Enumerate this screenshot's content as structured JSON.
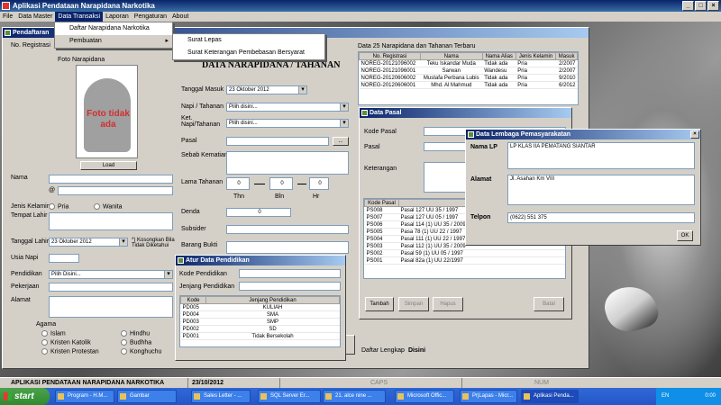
{
  "app": {
    "title": "Aplikasi Pendataan Narapidana Narkotika",
    "window_buttons": [
      "_",
      "□",
      "×"
    ]
  },
  "menubar": [
    {
      "label": "File",
      "active": false
    },
    {
      "label": "Data Master",
      "active": false
    },
    {
      "label": "Data Transaksi",
      "active": true
    },
    {
      "label": "Laporan",
      "active": false
    },
    {
      "label": "Pengaturan",
      "active": false
    },
    {
      "label": "About",
      "active": false
    }
  ],
  "menu_dropdown": {
    "items": [
      "Daftar Narapidana Narkotika",
      "Pembuatan"
    ],
    "submenu": [
      "Surat Lepas",
      "Surat Keterangan Pembebasan Bersyarat"
    ]
  },
  "pendaftaran": {
    "title": "Pendaftaran",
    "no_registrasi_label": "No. Registrasi",
    "foto_label": "Foto Narapidana",
    "photo_placeholder": "Foto tidak ada",
    "load_button": "Load",
    "nama_label": "Nama",
    "alias_label": "@",
    "jenis_kelamin_label": "Jenis Kelamin",
    "jenis_kelamin_options": [
      "Pria",
      "Wanita"
    ],
    "tempat_lahir_label": "Tempat Lahir",
    "tanggal_lahir_label": "Tanggal Lahir",
    "tanggal_lahir_value": "23  Oktober  2012",
    "kosongkan_label": "*) Kosongkan Bila Tidak Diketahui",
    "usia_label": "Usia Napi",
    "pendidikan_label": "Pendidikan",
    "pendidikan_value": "Pilih Disini...",
    "pekerjaan_label": "Pekerjaan",
    "alamat_label": "Alamat",
    "agama_label": "Agama",
    "agama_options": [
      "Islam",
      "Hindhu",
      "Kristen Katolik",
      "Budhha",
      "Kristen Protestan",
      "Konghuchu"
    ],
    "heading": "DATA NARAPIDANA / TAHANAN",
    "tanggal_masuk_label": "Tanggal Masuk",
    "tanggal_masuk_value": "23  Oktober  2012",
    "napi_tahanan_label": "Napi / Tahanan",
    "napi_tahanan_value": "Pilih disini...",
    "ket_label": "Ket. Napi/Tahanan",
    "ket_value": "Pilih disini...",
    "pasal_label": "Pasal",
    "pasal_button": "...",
    "sebab_label": "Sebab Kematian",
    "lama_tahanan_label": "Lama Tahanan",
    "lama_values": [
      "0",
      "0",
      "0"
    ],
    "lama_units": [
      "Thn",
      "Bln",
      "Hr"
    ],
    "denda_label": "Denda",
    "denda_value": "0",
    "subsider_label": "Subsider",
    "barang_bukti_label": "Barang Bukti",
    "daftar_lengkap_label": "Daftar Lengkap",
    "disini_label": "Disini"
  },
  "narapidana_table": {
    "title": "Data 25 Narapidana dan Tahanan Terbaru",
    "columns": [
      "No. Registrasi",
      "Nama",
      "Nama Alias",
      "Jenis Kelamin",
      "Masuk"
    ],
    "rows": [
      [
        "NOREG-20121096002",
        "Teku Iskandar Muda",
        "Tidak ada",
        "Pria",
        "2/2007"
      ],
      [
        "NOREG-20121096001",
        "Sarwan",
        "Wandesu",
        "Pria",
        "2/2007"
      ],
      [
        "NOREG-20120606002",
        "Mustafa Perbana Lubis",
        "Tidak ada",
        "Pria",
        "9/2010"
      ],
      [
        "NOREG-20120606001",
        "Mhd. Al Mahmud",
        "Tidak ada",
        "Pria",
        "6/2012"
      ]
    ]
  },
  "data_pasal": {
    "title": "Data Pasal",
    "kode_label": "Kode Pasal",
    "pasal_label": "Pasal",
    "keterangan_label": "Keterangan",
    "columns": [
      "Kode Pasal",
      "Pasal"
    ],
    "rows": [
      [
        "PS008",
        "Pasal 127 UU 35 / 1997"
      ],
      [
        "PS007",
        "Pasal 127 UU 05 / 1997"
      ],
      [
        "PS006",
        "Pasal 114 (1) UU 35 / 2009"
      ],
      [
        "PS005",
        "Pasa 78 (1) UU 22 / 1997"
      ],
      [
        "PS004",
        "Pasal 111 (1) UU 22 / 1997"
      ],
      [
        "PS003",
        "Pasal 112 (1) UU 35 / 2009"
      ],
      [
        "PS002",
        "Pasal 59 (1) UU 05 / 1997"
      ],
      [
        "PS001",
        "Pasal 82a (1) UU 22/1997"
      ]
    ],
    "buttons": [
      "Tambah",
      "Simpan",
      "Hapus",
      "Batal"
    ]
  },
  "lembaga": {
    "title": "Data Lembaga Pemasyarakatan",
    "nama_label": "Nama LP",
    "nama_value": "LP KLAS IIA PEMATANG SIANTAR",
    "alamat_label": "Alamat",
    "alamat_value": "Jl. Asahan Km VIII",
    "telpon_label": "Telpon",
    "telpon_value": "(0622) 551 375",
    "ok_button": "OK"
  },
  "pendidikan": {
    "title": "Atur Data Pendidikan",
    "kode_label": "Kode Pendidikan",
    "jenjang_label": "Jenjang Pendidikan",
    "columns": [
      "Kode",
      "Jenjang Pendidikan"
    ],
    "rows": [
      [
        "PD005",
        "KULIAH"
      ],
      [
        "PD004",
        "SMA"
      ],
      [
        "PD003",
        "SMP"
      ],
      [
        "PD002",
        "SD"
      ],
      [
        "PD001",
        "Tidak Bersekolah"
      ]
    ]
  },
  "statusbar": {
    "app_name": "APLIKASI PENDATAAN NARAPIDANA NARKOTIKA",
    "date": "23/10/2012",
    "caps": "CAPS",
    "num": "NUM"
  },
  "taskbar": {
    "start": "start",
    "tasks": [
      {
        "label": "Program - H.M...",
        "active": false
      },
      {
        "label": "Gambar",
        "active": false
      },
      {
        "label": "Sales Letter - ...",
        "active": false
      },
      {
        "label": "SQL Server Er...",
        "active": false
      },
      {
        "label": "21. alce nine ...",
        "active": false
      },
      {
        "label": "Microsoft Offic...",
        "active": false
      },
      {
        "label": "PrjLapas - Micr...",
        "active": false
      },
      {
        "label": "Aplikasi Penda...",
        "active": true
      }
    ],
    "tray_lang": "EN",
    "clock": "0:00"
  },
  "colors": {
    "titlebar": "#0a246a",
    "face": "#d4d0c8",
    "taskbar": "#3168d5",
    "photo_text": "#d13030"
  },
  "icons": [
    "app-icon",
    "window-icon",
    "close-icon",
    "chevron-down-icon",
    "submenu-arrow-icon",
    "windows-flag-icon"
  ]
}
